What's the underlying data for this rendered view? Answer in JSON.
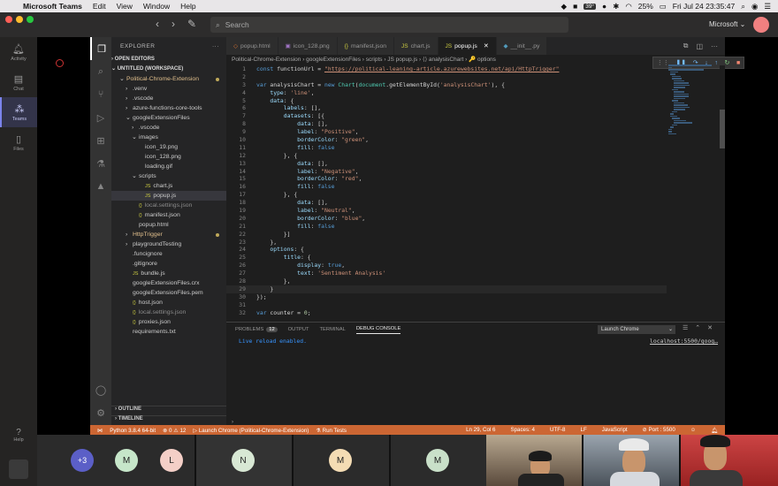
{
  "menubar": {
    "app": "Microsoft Teams",
    "items": [
      "Edit",
      "View",
      "Window",
      "Help"
    ],
    "temp": "39°",
    "battery": "25%",
    "clock": "Fri Jul 24  23:35:47"
  },
  "teams": {
    "search_placeholder": "Search",
    "org": "Microsoft",
    "rail": [
      "Activity",
      "Chat",
      "Teams",
      "Files"
    ],
    "help": "Help"
  },
  "vscode": {
    "explorer_title": "EXPLORER",
    "open_editors": "OPEN EDITORS",
    "workspace": "UNTITLED (WORKSPACE)",
    "tree": [
      {
        "label": "Political-Chrome-Extension",
        "indent": 1,
        "cls": "yellow",
        "arrow": "⌄",
        "dot": true
      },
      {
        "label": ".venv",
        "indent": 2,
        "cls": "",
        "arrow": "›"
      },
      {
        "label": ".vscode",
        "indent": 2,
        "cls": "",
        "arrow": "›"
      },
      {
        "label": "azure-functions-core-tools",
        "indent": 2,
        "cls": "",
        "arrow": "›"
      },
      {
        "label": "googleExtensionFiles",
        "indent": 2,
        "cls": "",
        "arrow": "⌄"
      },
      {
        "label": ".vscode",
        "indent": 3,
        "cls": "",
        "arrow": "›"
      },
      {
        "label": "images",
        "indent": 3,
        "cls": "",
        "arrow": "⌄"
      },
      {
        "label": "icon_19.png",
        "indent": 4,
        "cls": "",
        "arrow": ""
      },
      {
        "label": "icon_128.png",
        "indent": 4,
        "cls": "",
        "arrow": ""
      },
      {
        "label": "loading.gif",
        "indent": 4,
        "cls": "",
        "arrow": ""
      },
      {
        "label": "scripts",
        "indent": 3,
        "cls": "",
        "arrow": "⌄"
      },
      {
        "label": "chart.js",
        "indent": 4,
        "cls": "",
        "arrow": "",
        "icon": "JS"
      },
      {
        "label": "popup.js",
        "indent": 4,
        "cls": "",
        "arrow": "",
        "icon": "JS",
        "sel": true
      },
      {
        "label": "local.settings.json",
        "indent": 3,
        "cls": "dim",
        "arrow": "",
        "icon": "{}"
      },
      {
        "label": "manifest.json",
        "indent": 3,
        "cls": "",
        "arrow": "",
        "icon": "{}"
      },
      {
        "label": "popup.html",
        "indent": 3,
        "cls": "",
        "arrow": ""
      },
      {
        "label": "HttpTrigger",
        "indent": 2,
        "cls": "yellow",
        "arrow": "›",
        "dot": true
      },
      {
        "label": "playgroundTesting",
        "indent": 2,
        "cls": "",
        "arrow": "›"
      },
      {
        "label": ".funcignore",
        "indent": 2,
        "cls": "",
        "arrow": ""
      },
      {
        "label": ".gitignore",
        "indent": 2,
        "cls": "",
        "arrow": ""
      },
      {
        "label": "bundle.js",
        "indent": 2,
        "cls": "",
        "arrow": "",
        "icon": "JS"
      },
      {
        "label": "googleExtensionFiles.crx",
        "indent": 2,
        "cls": "",
        "arrow": ""
      },
      {
        "label": "googleExtensionFiles.pem",
        "indent": 2,
        "cls": "",
        "arrow": ""
      },
      {
        "label": "host.json",
        "indent": 2,
        "cls": "",
        "arrow": "",
        "icon": "{}"
      },
      {
        "label": "local.settings.json",
        "indent": 2,
        "cls": "dim",
        "arrow": "",
        "icon": "{}"
      },
      {
        "label": "proxies.json",
        "indent": 2,
        "cls": "",
        "arrow": "",
        "icon": "{}"
      },
      {
        "label": "requirements.txt",
        "indent": 2,
        "cls": "",
        "arrow": ""
      }
    ],
    "outline": "OUTLINE",
    "timeline": "TIMELINE",
    "tabs": [
      {
        "label": "popup.html",
        "icon": "◇",
        "color": "#e37933"
      },
      {
        "label": "icon_128.png",
        "icon": "▣",
        "color": "#a074c4"
      },
      {
        "label": "manifest.json",
        "icon": "{}",
        "color": "#cbcb41"
      },
      {
        "label": "chart.js",
        "icon": "JS",
        "color": "#cbcb41"
      },
      {
        "label": "popup.js",
        "icon": "JS",
        "color": "#cbcb41",
        "active": true
      },
      {
        "label": "__init__.py",
        "icon": "◆",
        "color": "#519aba"
      }
    ],
    "breadcrumb": "Political-Chrome-Extension  ›  googleExtensionFiles  ›  scripts  ›  JS  popup.js  ›  ⟨⟩  analysisChart  ›  🔑 options",
    "code": [
      "const functionUrl = \"https://political-leaning-article.azurewebsites.net/api/HttpTrigger\"",
      "",
      "var analysisChart = new Chart(document.getElementById('analysisChart'), {",
      "    type: 'line',",
      "    data: {",
      "        labels: [],",
      "        datasets: [{",
      "            data: [],",
      "            label: \"Positive\",",
      "            borderColor: \"green\",",
      "            fill: false",
      "        }, {",
      "            data: [],",
      "            label: \"Negative\",",
      "            borderColor: \"red\",",
      "            fill: false",
      "        }, {",
      "            data: [],",
      "            label: \"Neutral\",",
      "            borderColor: \"blue\",",
      "            fill: false",
      "        }]",
      "    },",
      "    options: {",
      "        title: {",
      "            display: true,",
      "            text: 'Sentiment Analysis'",
      "        },",
      "    }",
      "});",
      "",
      "var counter = 0;"
    ],
    "panel_tabs": [
      "PROBLEMS",
      "OUTPUT",
      "TERMINAL",
      "DEBUG CONSOLE"
    ],
    "problems_count": "12",
    "launch_config": "Launch Chrome",
    "console_message": "Live reload enabled.",
    "console_source": "localhost:5500/goog…",
    "status": {
      "python": "Python 3.8.4 64-bit",
      "errors": "⊗ 0 ⚠ 12",
      "launch": "▷ Launch Chrome (Political-Chrome-Extension)",
      "tests": "⚗ Run Tests",
      "position": "Ln 29, Col 6",
      "spaces": "Spaces: 4",
      "encoding": "UTF-8",
      "eol": "LF",
      "language": "JavaScript",
      "port": "⊘ Port : 5500"
    }
  },
  "call": {
    "overflow": "+3",
    "participants": [
      "M",
      "L",
      "N",
      "M",
      "M"
    ]
  }
}
